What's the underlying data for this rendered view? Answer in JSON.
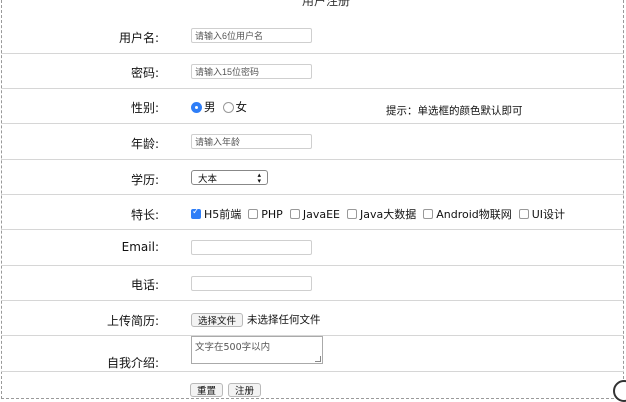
{
  "legend": "用户注册",
  "fields": {
    "username": {
      "label": "用户名:",
      "placeholder": "请输入6位用户名"
    },
    "password": {
      "label": "密码:",
      "placeholder": "请输入15位密码"
    },
    "gender": {
      "label": "性别:",
      "options": [
        "男",
        "女"
      ],
      "hint": "提示：单选框的颜色默认即可"
    },
    "age": {
      "label": "年龄:",
      "placeholder": "请输入年龄"
    },
    "education": {
      "label": "学历:",
      "value": "大本"
    },
    "skills": {
      "label": "特长:",
      "options": [
        "H5前端",
        "PHP",
        "JavaEE",
        "Java大数据",
        "Android物联网",
        "UI设计"
      ]
    },
    "email": {
      "label": "Email:"
    },
    "phone": {
      "label": "电话:"
    },
    "resume": {
      "label": "上传简历:",
      "button": "选择文件",
      "status": "未选择任何文件"
    },
    "intro": {
      "label": "自我介绍:",
      "placeholder": "文字在500字以内"
    }
  },
  "actions": {
    "reset": "重置",
    "submit": "注册"
  }
}
